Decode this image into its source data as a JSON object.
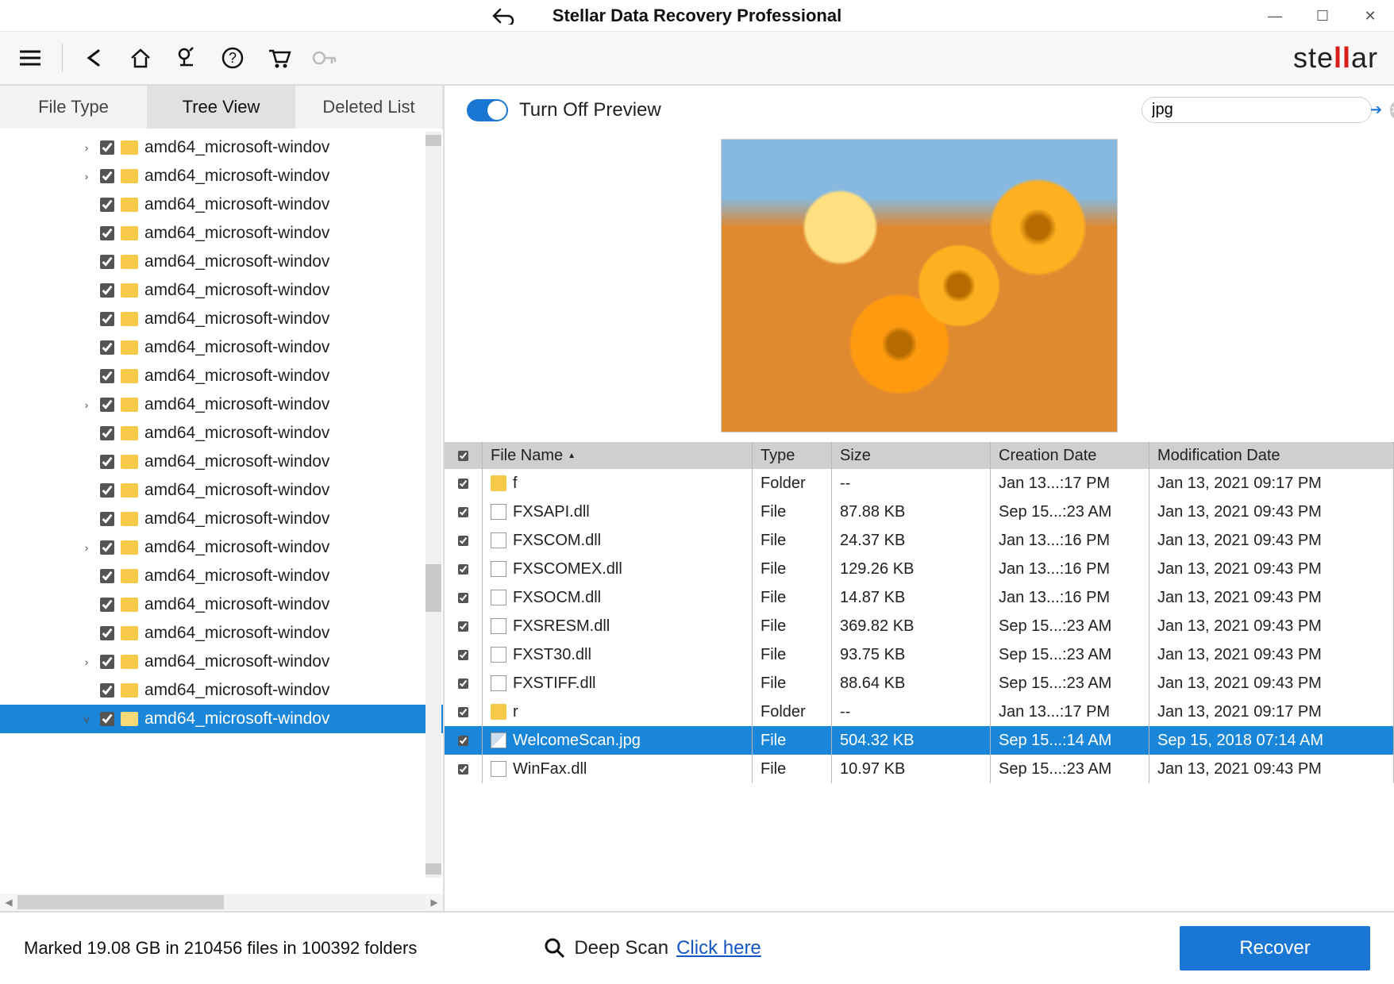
{
  "window": {
    "title": "Stellar Data Recovery Professional"
  },
  "brand": {
    "pre": "ste",
    "mid": "ll",
    "post": "ar"
  },
  "tabs": {
    "file_type": "File Type",
    "tree_view": "Tree View",
    "deleted_list": "Deleted List"
  },
  "preview": {
    "toggle_label": "Turn Off Preview"
  },
  "search": {
    "value": "jpg"
  },
  "tree_items": [
    {
      "expandable": true,
      "label": "amd64_microsoft-windov"
    },
    {
      "expandable": true,
      "label": "amd64_microsoft-windov"
    },
    {
      "expandable": false,
      "label": "amd64_microsoft-windov"
    },
    {
      "expandable": false,
      "label": "amd64_microsoft-windov"
    },
    {
      "expandable": false,
      "label": "amd64_microsoft-windov"
    },
    {
      "expandable": false,
      "label": "amd64_microsoft-windov"
    },
    {
      "expandable": false,
      "label": "amd64_microsoft-windov"
    },
    {
      "expandable": false,
      "label": "amd64_microsoft-windov"
    },
    {
      "expandable": false,
      "label": "amd64_microsoft-windov"
    },
    {
      "expandable": true,
      "label": "amd64_microsoft-windov"
    },
    {
      "expandable": false,
      "label": "amd64_microsoft-windov"
    },
    {
      "expandable": false,
      "label": "amd64_microsoft-windov"
    },
    {
      "expandable": false,
      "label": "amd64_microsoft-windov"
    },
    {
      "expandable": false,
      "label": "amd64_microsoft-windov"
    },
    {
      "expandable": true,
      "label": "amd64_microsoft-windov"
    },
    {
      "expandable": false,
      "label": "amd64_microsoft-windov"
    },
    {
      "expandable": false,
      "label": "amd64_microsoft-windov"
    },
    {
      "expandable": false,
      "label": "amd64_microsoft-windov"
    },
    {
      "expandable": true,
      "label": "amd64_microsoft-windov"
    },
    {
      "expandable": false,
      "label": "amd64_microsoft-windov"
    },
    {
      "expandable": false,
      "label": "amd64_microsoft-windov",
      "selected": true,
      "open": true,
      "expander": "v"
    }
  ],
  "columns": {
    "name": "File Name",
    "type": "Type",
    "size": "Size",
    "cdate": "Creation Date",
    "mdate": "Modification Date"
  },
  "files": [
    {
      "icon": "folder",
      "name": "f",
      "type": "Folder",
      "size": "--",
      "cdate": "Jan 13...:17 PM",
      "mdate": "Jan 13, 2021 09:17 PM"
    },
    {
      "icon": "file",
      "name": "FXSAPI.dll",
      "type": "File",
      "size": "87.88 KB",
      "cdate": "Sep 15...:23 AM",
      "mdate": "Jan 13, 2021 09:43 PM"
    },
    {
      "icon": "file",
      "name": "FXSCOM.dll",
      "type": "File",
      "size": "24.37 KB",
      "cdate": "Jan 13...:16 PM",
      "mdate": "Jan 13, 2021 09:43 PM"
    },
    {
      "icon": "file",
      "name": "FXSCOMEX.dll",
      "type": "File",
      "size": "129.26 KB",
      "cdate": "Jan 13...:16 PM",
      "mdate": "Jan 13, 2021 09:43 PM"
    },
    {
      "icon": "file",
      "name": "FXSOCM.dll",
      "type": "File",
      "size": "14.87 KB",
      "cdate": "Jan 13...:16 PM",
      "mdate": "Jan 13, 2021 09:43 PM"
    },
    {
      "icon": "file",
      "name": "FXSRESM.dll",
      "type": "File",
      "size": "369.82 KB",
      "cdate": "Sep 15...:23 AM",
      "mdate": "Jan 13, 2021 09:43 PM"
    },
    {
      "icon": "file",
      "name": "FXST30.dll",
      "type": "File",
      "size": "93.75 KB",
      "cdate": "Sep 15...:23 AM",
      "mdate": "Jan 13, 2021 09:43 PM"
    },
    {
      "icon": "file",
      "name": "FXSTIFF.dll",
      "type": "File",
      "size": "88.64 KB",
      "cdate": "Sep 15...:23 AM",
      "mdate": "Jan 13, 2021 09:43 PM"
    },
    {
      "icon": "folder",
      "name": "r",
      "type": "Folder",
      "size": "--",
      "cdate": "Jan 13...:17 PM",
      "mdate": "Jan 13, 2021 09:17 PM"
    },
    {
      "icon": "image",
      "name": "WelcomeScan.jpg",
      "type": "File",
      "size": "504.32 KB",
      "cdate": "Sep 15...:14 AM",
      "mdate": "Sep 15, 2018 07:14 AM",
      "selected": true
    },
    {
      "icon": "file",
      "name": "WinFax.dll",
      "type": "File",
      "size": "10.97 KB",
      "cdate": "Sep 15...:23 AM",
      "mdate": "Jan 13, 2021 09:43 PM"
    }
  ],
  "footer": {
    "status": "Marked 19.08 GB in 210456 files in 100392 folders",
    "deep_label": "Deep Scan",
    "deep_link": "Click here",
    "recover": "Recover"
  }
}
